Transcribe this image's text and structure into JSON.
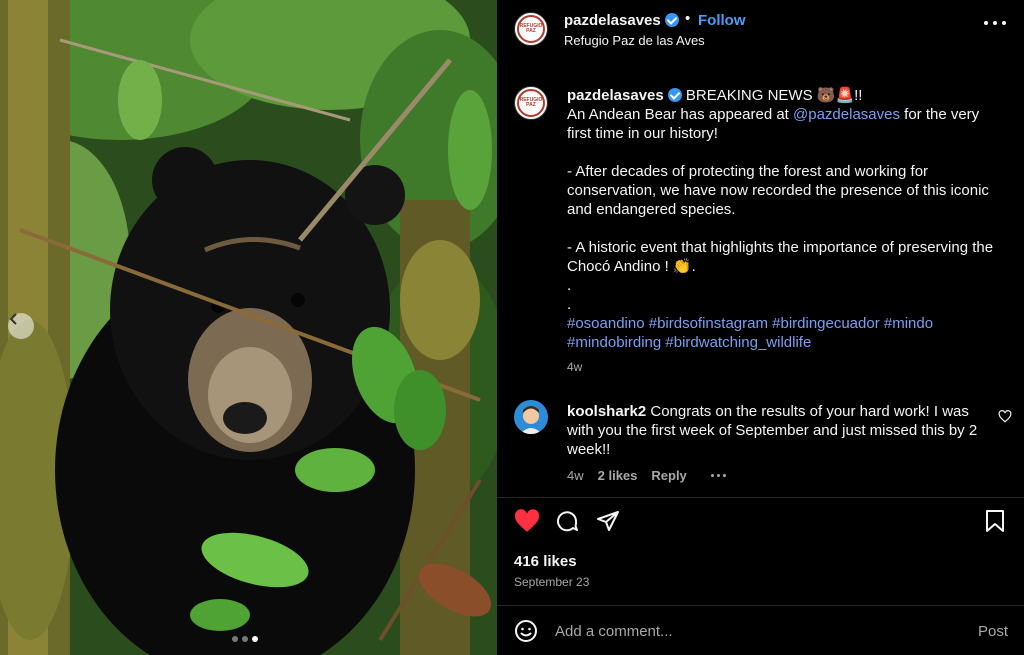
{
  "post": {
    "username": "pazdelasaves",
    "follow_separator": "•",
    "follow_label": "Follow",
    "location": "Refugio Paz de las Aves",
    "logo_text": "REFUGIO PAZ",
    "caption": {
      "username": "pazdelasaves",
      "line1_prefix": "BREAKING NEWS 🐻🚨!!",
      "line2_a": "An Andean Bear has appeared at ",
      "mention": "@pazdelasaves",
      "line2_b": " for the very first time in our history!",
      "para2": "- After decades of protecting the forest and working for conservation, we have now recorded the presence of this iconic and endangered species.",
      "para3": "- A historic event that highlights the importance of preserving the Chocó Andino ! 👏.",
      "dot1": ".",
      "dot2": ".",
      "hashtags": "#osoandino #birdsofinstagram #birdingecuador #mindo #mindobirding #birdwatching_wildlife",
      "time": "4w"
    },
    "comment": {
      "username": "koolshark2",
      "text": " Congrats on the results of your hard work! I was with you the first week of September and just missed this by 2 week!!",
      "time": "4w",
      "likes": "2 likes",
      "reply_label": "Reply"
    },
    "likes": "416 likes",
    "date": "September 23",
    "comment_placeholder": "Add a comment...",
    "post_label": "Post"
  },
  "icons": {
    "like": "heart-filled-icon",
    "comment": "comment-bubble-icon",
    "share": "paper-plane-icon",
    "save": "bookmark-icon",
    "emoji": "smiley-icon",
    "more": "ellipsis-icon",
    "carousel_prev": "chevron-left-icon"
  },
  "colors": {
    "background": "#000000",
    "link": "#7b9ff2",
    "follow": "#4a9df8",
    "heart": "#ff3040",
    "muted": "#a8a8a8",
    "verified": "#3897f0"
  },
  "carousel": {
    "count": 3,
    "active_index": 2
  }
}
